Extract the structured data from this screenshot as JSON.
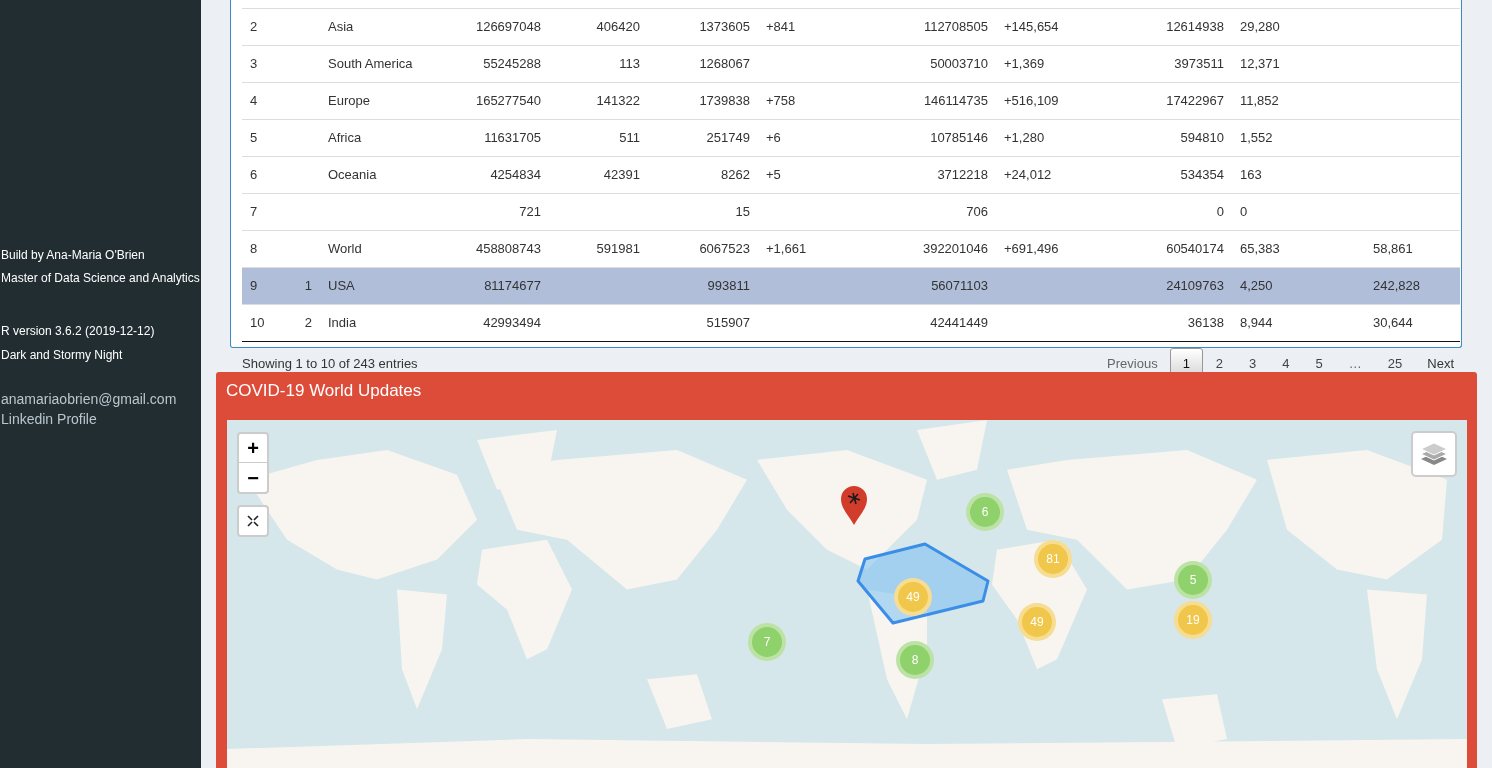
{
  "sidebar": {
    "credits": [
      "Build by Ana-Maria O'Brien",
      "Master of Data Science and Analytics"
    ],
    "info": [
      "R version 3.6.2 (2019-12-12)",
      "Dark and Stormy Night"
    ],
    "email": "anamariaobrien@gmail.com",
    "profile_link": "Linkedin Profile"
  },
  "table": {
    "rows": [
      {
        "selected": false,
        "cells": [
          "2",
          "",
          "Asia",
          "126697048",
          "406420",
          "1373605",
          "+841",
          "112708505",
          "+145,654",
          "12614938",
          "29,280",
          ""
        ]
      },
      {
        "selected": false,
        "cells": [
          "3",
          "",
          "South America",
          "55245288",
          "113",
          "1268067",
          "",
          "50003710",
          "+1,369",
          "3973511",
          "12,371",
          ""
        ]
      },
      {
        "selected": false,
        "cells": [
          "4",
          "",
          "Europe",
          "165277540",
          "141322",
          "1739838",
          "+758",
          "146114735",
          "+516,109",
          "17422967",
          "11,852",
          ""
        ]
      },
      {
        "selected": false,
        "cells": [
          "5",
          "",
          "Africa",
          "11631705",
          "511",
          "251749",
          "+6",
          "10785146",
          "+1,280",
          "594810",
          "1,552",
          ""
        ]
      },
      {
        "selected": false,
        "cells": [
          "6",
          "",
          "Oceania",
          "4254834",
          "42391",
          "8262",
          "+5",
          "3712218",
          "+24,012",
          "534354",
          "163",
          ""
        ]
      },
      {
        "selected": false,
        "cells": [
          "7",
          "",
          "",
          "721",
          "",
          "15",
          "",
          "706",
          "",
          "0",
          "0",
          ""
        ]
      },
      {
        "selected": false,
        "cells": [
          "8",
          "",
          "World",
          "458808743",
          "591981",
          "6067523",
          "+1,661",
          "392201046",
          "+691,496",
          "60540174",
          "65,383",
          "58,861"
        ]
      },
      {
        "selected": true,
        "cells": [
          "9",
          "1",
          "USA",
          "81174677",
          "",
          "993811",
          "",
          "56071103",
          "",
          "24109763",
          "4,250",
          "242,828"
        ]
      },
      {
        "selected": false,
        "cells": [
          "10",
          "2",
          "India",
          "42993494",
          "",
          "515907",
          "",
          "42441449",
          "",
          "36138",
          "8,944",
          "30,644"
        ]
      }
    ],
    "info": "Showing 1 to 10 of 243 entries",
    "pagination": {
      "previous": "Previous",
      "next": "Next",
      "pages": [
        {
          "label": "1",
          "kind": "page",
          "selected": true
        },
        {
          "label": "2",
          "kind": "page",
          "selected": false
        },
        {
          "label": "3",
          "kind": "page",
          "selected": false
        },
        {
          "label": "4",
          "kind": "page",
          "selected": false
        },
        {
          "label": "5",
          "kind": "page",
          "selected": false
        },
        {
          "label": "…",
          "kind": "ellipsis"
        },
        {
          "label": "25",
          "kind": "page",
          "selected": false
        }
      ]
    }
  },
  "map_panel": {
    "title": "COVID-19 World Updates",
    "zoom_in": "+",
    "zoom_out": "−",
    "clusters": [
      {
        "count": "6",
        "color": "#8fd16a"
      },
      {
        "count": "81",
        "color": "#f0c74a"
      },
      {
        "count": "5",
        "color": "#8fd16a"
      },
      {
        "count": "19",
        "color": "#f0c74a"
      },
      {
        "count": "49",
        "color": "#f0c74a"
      },
      {
        "count": "49",
        "color": "#f0c74a"
      },
      {
        "count": "8",
        "color": "#8fd16a"
      },
      {
        "count": "7",
        "color": "#8fd16a"
      }
    ]
  }
}
